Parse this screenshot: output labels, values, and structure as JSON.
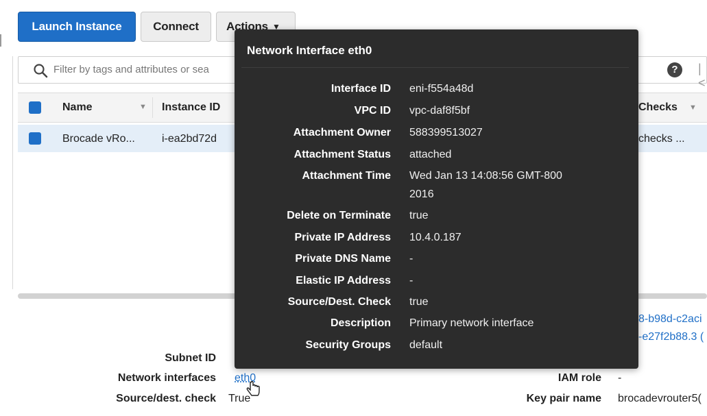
{
  "toolbar": {
    "launch": "Launch Instance",
    "connect": "Connect",
    "actions": "Actions"
  },
  "search": {
    "placeholder": "Filter by tags and attributes or sea"
  },
  "table": {
    "headers": {
      "name": "Name",
      "instance_id": "Instance ID",
      "checks": "Checks"
    },
    "row": {
      "name": "Brocade vRo...",
      "instance_id": "i-ea2bd72d",
      "checks": "checks ..."
    }
  },
  "details_partial": {
    "line1": "8-b98d-c2aci",
    "line2": "-e27f2b88.3 ("
  },
  "details": {
    "subnet_label": "Subnet ID",
    "netif_label": "Network interfaces",
    "netif_value": "eth0",
    "srcdest_label": "Source/dest. check",
    "srcdest_value": "True",
    "iam_label": "IAM role",
    "iam_value": "-",
    "keypair_label": "Key pair name",
    "keypair_value": "brocadevrouter5("
  },
  "tooltip": {
    "title": "Network Interface eth0",
    "rows": [
      {
        "label": "Interface ID",
        "value": "eni-f554a48d"
      },
      {
        "label": "VPC ID",
        "value": "vpc-daf8f5bf"
      },
      {
        "label": "Attachment Owner",
        "value": "588399513027"
      },
      {
        "label": "Attachment Status",
        "value": "attached"
      },
      {
        "label": "Attachment Time",
        "value": "Wed Jan 13 14:08:56 GMT-800 2016"
      },
      {
        "label": "Delete on Terminate",
        "value": "true"
      },
      {
        "label": "Private IP Address",
        "value": "10.4.0.187"
      },
      {
        "label": "Private DNS Name",
        "value": "-"
      },
      {
        "label": "Elastic IP Address",
        "value": "-"
      },
      {
        "label": "Source/Dest. Check",
        "value": "true"
      },
      {
        "label": "Description",
        "value": "Primary network interface"
      },
      {
        "label": "Security Groups",
        "value": "default"
      }
    ]
  }
}
